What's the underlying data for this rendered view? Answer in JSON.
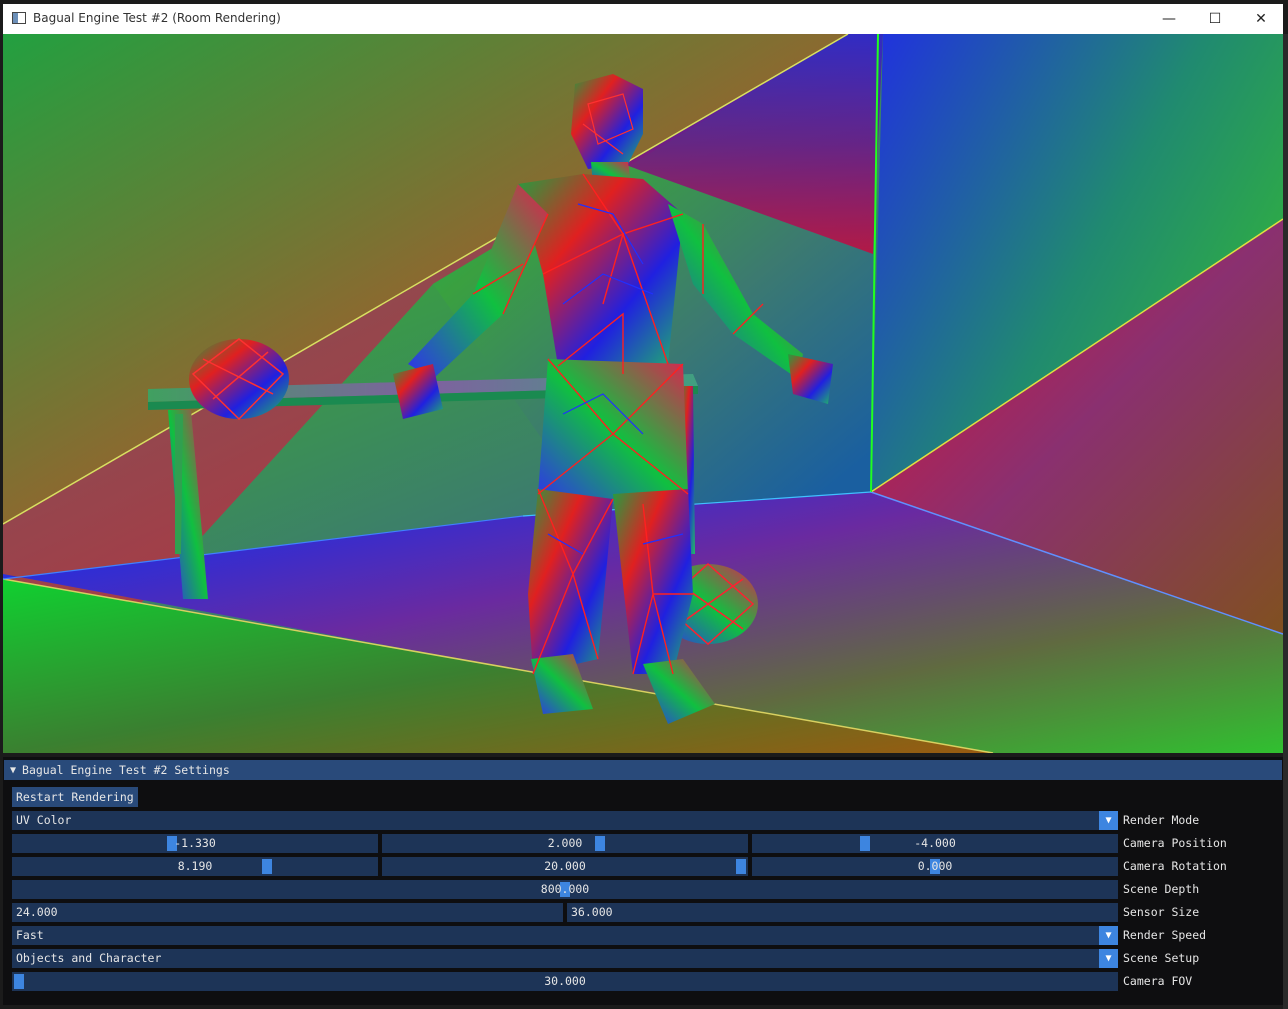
{
  "window": {
    "title": "Bagual Engine Test #2 (Room Rendering)",
    "minimize_glyph": "—",
    "maximize_glyph": "☐",
    "close_glyph": "✕"
  },
  "settings": {
    "title": "Bagual Engine Test #2 Settings",
    "collapse_glyph": "▼",
    "restart_label": "Restart Rendering",
    "dropdown_glyph": "▼",
    "render_mode": {
      "label": "Render Mode",
      "value": "UV Color"
    },
    "camera_position": {
      "label": "Camera Position",
      "x": "-1.330",
      "y": "2.000",
      "z": "-4.000"
    },
    "camera_rotation": {
      "label": "Camera Rotation",
      "x": "8.190",
      "y": "20.000",
      "z": "0.000"
    },
    "scene_depth": {
      "label": "Scene Depth",
      "value": "800.000"
    },
    "sensor_size": {
      "label": "Sensor Size",
      "w": "24.000",
      "h": "36.000"
    },
    "render_speed": {
      "label": "Render Speed",
      "value": "Fast"
    },
    "scene_setup": {
      "label": "Scene Setup",
      "value": "Objects and Character"
    },
    "camera_fov": {
      "label": "Camera FOV",
      "value": "30.000"
    }
  },
  "colors": {
    "header_blue": "#294a7a",
    "field_blue": "#1d3457",
    "grab_blue": "#3d85e0"
  }
}
